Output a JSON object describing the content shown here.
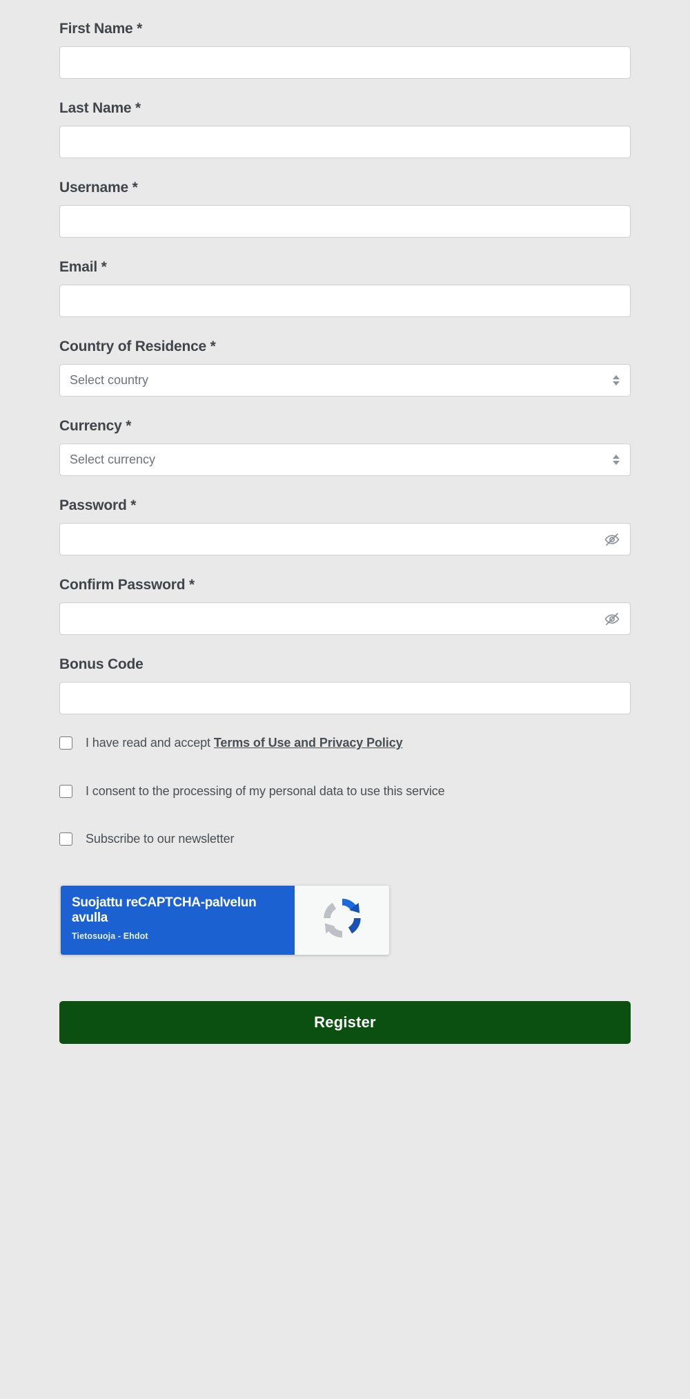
{
  "theme": {
    "page_background": "#e9e9e9",
    "input_background": "#ffffff",
    "input_border": "#ccd1d1",
    "label_color": "#414549",
    "register_button_color": "#0b5010",
    "recaptcha_blue": "#1b61d1"
  },
  "form": {
    "fields": [
      {
        "id": "first-name",
        "label": "First Name *",
        "type": "text",
        "value": "",
        "placeholder": ""
      },
      {
        "id": "last-name",
        "label": "Last Name *",
        "type": "text",
        "value": "",
        "placeholder": ""
      },
      {
        "id": "username",
        "label": "Username *",
        "type": "text",
        "value": "",
        "placeholder": ""
      },
      {
        "id": "email",
        "label": "Email *",
        "type": "text",
        "value": "",
        "placeholder": ""
      },
      {
        "id": "country",
        "label": "Country of Residence *",
        "type": "select",
        "value": "Select country"
      },
      {
        "id": "currency",
        "label": "Currency *",
        "type": "select",
        "value": "Select currency"
      },
      {
        "id": "password",
        "label": "Password *",
        "type": "password",
        "value": "",
        "placeholder": ""
      },
      {
        "id": "confirm-password",
        "label": "Confirm Password *",
        "type": "password",
        "value": "",
        "placeholder": ""
      },
      {
        "id": "bonus-code",
        "label": "Bonus Code",
        "type": "text",
        "value": "",
        "placeholder": ""
      }
    ],
    "labels": {
      "first_name": "First Name *",
      "last_name": "Last Name *",
      "username": "Username *",
      "email": "Email *",
      "country": "Country of Residence *",
      "currency": "Currency *",
      "password": "Password *",
      "confirm_password": "Confirm Password *",
      "bonus_code": "Bonus Code"
    },
    "values": {
      "first_name": "",
      "last_name": "",
      "username": "",
      "email": "",
      "country": "Select country",
      "currency": "Select currency",
      "password": "",
      "confirm_password": "",
      "bonus_code": ""
    },
    "password_toggle_icon": "eye-slash-icon",
    "select_arrow_icon": "updown-arrows-icon"
  },
  "checkboxes": [
    {
      "id": "terms",
      "checked": false,
      "text_before": "I have read and accept ",
      "link_text": "Terms of Use and Privacy Policy",
      "text_after": ""
    },
    {
      "id": "consent",
      "checked": false,
      "text_before": "I consent to the processing of my personal data to use this service",
      "link_text": "",
      "text_after": ""
    },
    {
      "id": "newsletter",
      "checked": false,
      "text_before": "Subscribe to our newsletter",
      "link_text": "",
      "text_after": ""
    }
  ],
  "recaptcha": {
    "title": "Suojattu reCAPTCHA-palvelun avulla",
    "privacy": "Tietosuoja",
    "separator": "-",
    "terms": "Ehdot",
    "sub_line": "Tietosuoja - Ehdot",
    "logo_icon": "recaptcha-logo-icon"
  },
  "submit": {
    "label": "Register"
  }
}
